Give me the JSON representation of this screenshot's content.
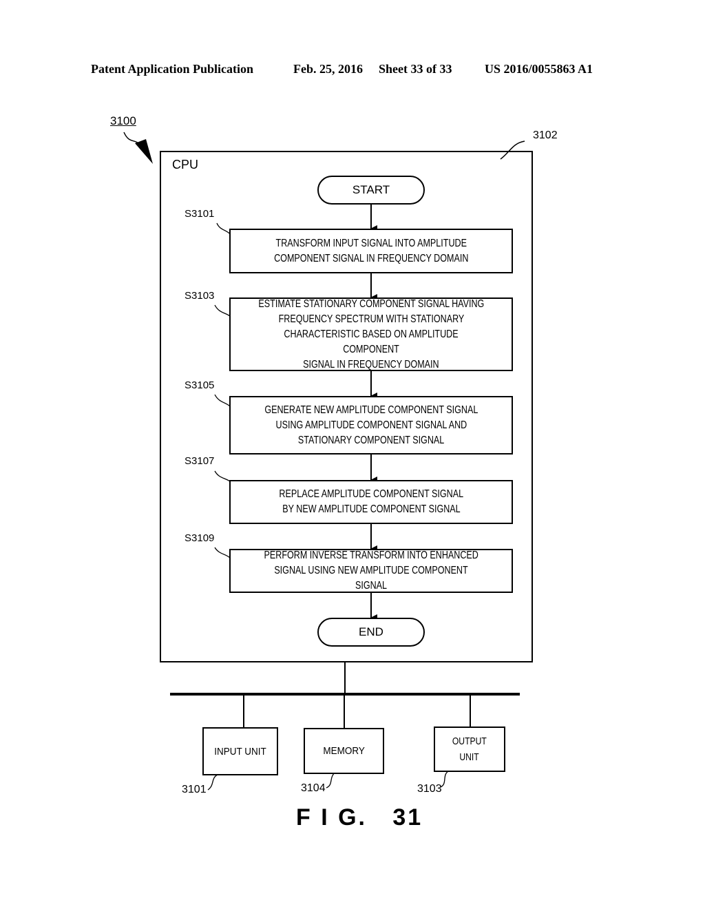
{
  "header": {
    "publication": "Patent Application Publication",
    "date": "Feb. 25, 2016",
    "sheet": "Sheet 33 of 33",
    "number": "US 2016/0055863 A1"
  },
  "diagram": {
    "system_ref": "3100",
    "cpu": {
      "label": "CPU",
      "ref": "3102"
    },
    "start_label": "START",
    "end_label": "END",
    "steps": [
      {
        "id": "S3101",
        "lines": [
          "TRANSFORM INPUT SIGNAL INTO AMPLITUDE",
          "COMPONENT SIGNAL IN FREQUENCY DOMAIN"
        ]
      },
      {
        "id": "S3103",
        "lines": [
          "ESTIMATE STATIONARY COMPONENT SIGNAL HAVING",
          "FREQUENCY SPECTRUM WITH STATIONARY",
          "CHARACTERISTIC BASED ON AMPLITUDE COMPONENT",
          "SIGNAL IN FREQUENCY DOMAIN"
        ]
      },
      {
        "id": "S3105",
        "lines": [
          "GENERATE NEW AMPLITUDE COMPONENT SIGNAL",
          "USING AMPLITUDE COMPONENT SIGNAL AND",
          "STATIONARY COMPONENT SIGNAL"
        ]
      },
      {
        "id": "S3107",
        "lines": [
          "REPLACE AMPLITUDE COMPONENT SIGNAL",
          "BY NEW AMPLITUDE COMPONENT SIGNAL"
        ]
      },
      {
        "id": "S3109",
        "lines": [
          "PERFORM INVERSE TRANSFORM INTO ENHANCED",
          "SIGNAL USING NEW AMPLITUDE COMPONENT SIGNAL"
        ]
      }
    ],
    "units": [
      {
        "lines": [
          "INPUT UNIT"
        ],
        "ref": "3101"
      },
      {
        "lines": [
          "MEMORY"
        ],
        "ref": "3104"
      },
      {
        "lines": [
          "OUTPUT",
          "UNIT"
        ],
        "ref": "3103"
      }
    ],
    "figure_label": "F I G.   31"
  }
}
